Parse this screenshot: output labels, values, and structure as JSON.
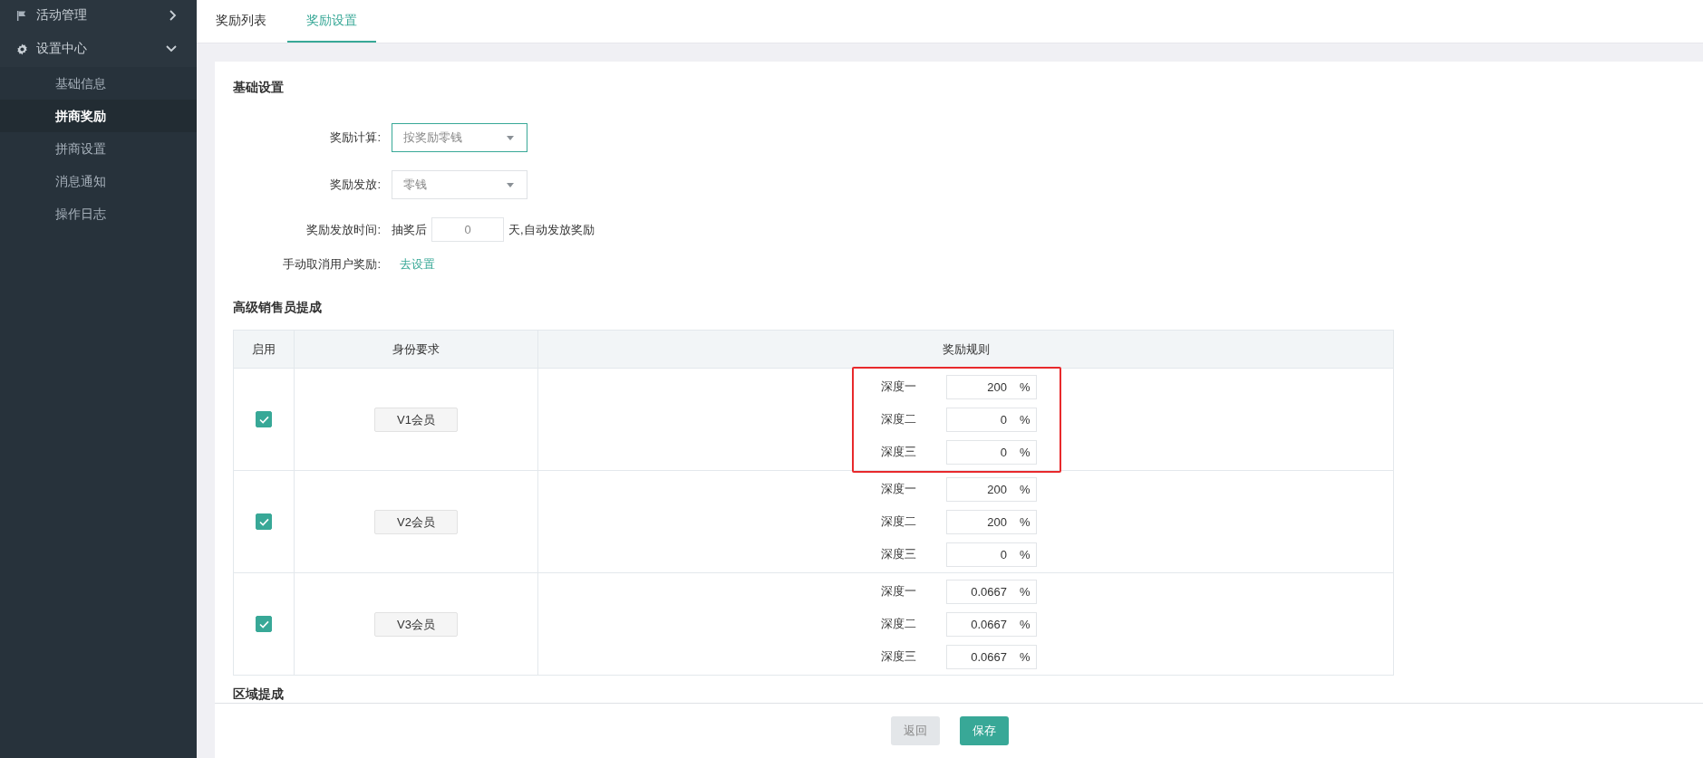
{
  "sidebar": {
    "items": [
      {
        "label": "活动管理",
        "expanded": false
      },
      {
        "label": "设置中心",
        "expanded": true,
        "children": [
          {
            "label": "基础信息",
            "selected": false
          },
          {
            "label": "拼商奖励",
            "selected": true
          },
          {
            "label": "拼商设置",
            "selected": false
          },
          {
            "label": "消息通知",
            "selected": false
          },
          {
            "label": "操作日志",
            "selected": false
          }
        ]
      }
    ]
  },
  "tabs": [
    {
      "label": "奖励列表",
      "selected": false
    },
    {
      "label": "奖励设置",
      "selected": true
    }
  ],
  "basic": {
    "title": "基础设置",
    "calc": {
      "label": "奖励计算:",
      "value": "按奖励零钱",
      "focused": true
    },
    "payout": {
      "label": "奖励发放:",
      "value": "零钱",
      "focused": false
    },
    "time": {
      "label": "奖励发放时间:",
      "prefix": "抽奖后",
      "value": "0",
      "suffix": "天,自动发放奖励"
    },
    "cancel": {
      "label": "手动取消用户奖励:",
      "link": "去设置"
    }
  },
  "advanced": {
    "title": "高级销售员提成",
    "columns": [
      "启用",
      "身份要求",
      "奖励规则"
    ],
    "rows": [
      {
        "enabled": true,
        "level": "V1会员",
        "highlighted": true,
        "rules": [
          {
            "label": "深度一",
            "value": "200",
            "unit": "%"
          },
          {
            "label": "深度二",
            "value": "0",
            "unit": "%"
          },
          {
            "label": "深度三",
            "value": "0",
            "unit": "%"
          }
        ]
      },
      {
        "enabled": true,
        "level": "V2会员",
        "highlighted": false,
        "rules": [
          {
            "label": "深度一",
            "value": "200",
            "unit": "%"
          },
          {
            "label": "深度二",
            "value": "200",
            "unit": "%"
          },
          {
            "label": "深度三",
            "value": "0",
            "unit": "%"
          }
        ]
      },
      {
        "enabled": true,
        "level": "V3会员",
        "highlighted": false,
        "rules": [
          {
            "label": "深度一",
            "value": "0.0667",
            "unit": "%"
          },
          {
            "label": "深度二",
            "value": "0.0667",
            "unit": "%"
          },
          {
            "label": "深度三",
            "value": "0.0667",
            "unit": "%"
          }
        ]
      }
    ]
  },
  "region": {
    "title": "区域提成"
  },
  "footer": {
    "buttons": [
      {
        "label": "返回",
        "kind": "secondary"
      },
      {
        "label": "保存",
        "kind": "primary"
      }
    ]
  }
}
